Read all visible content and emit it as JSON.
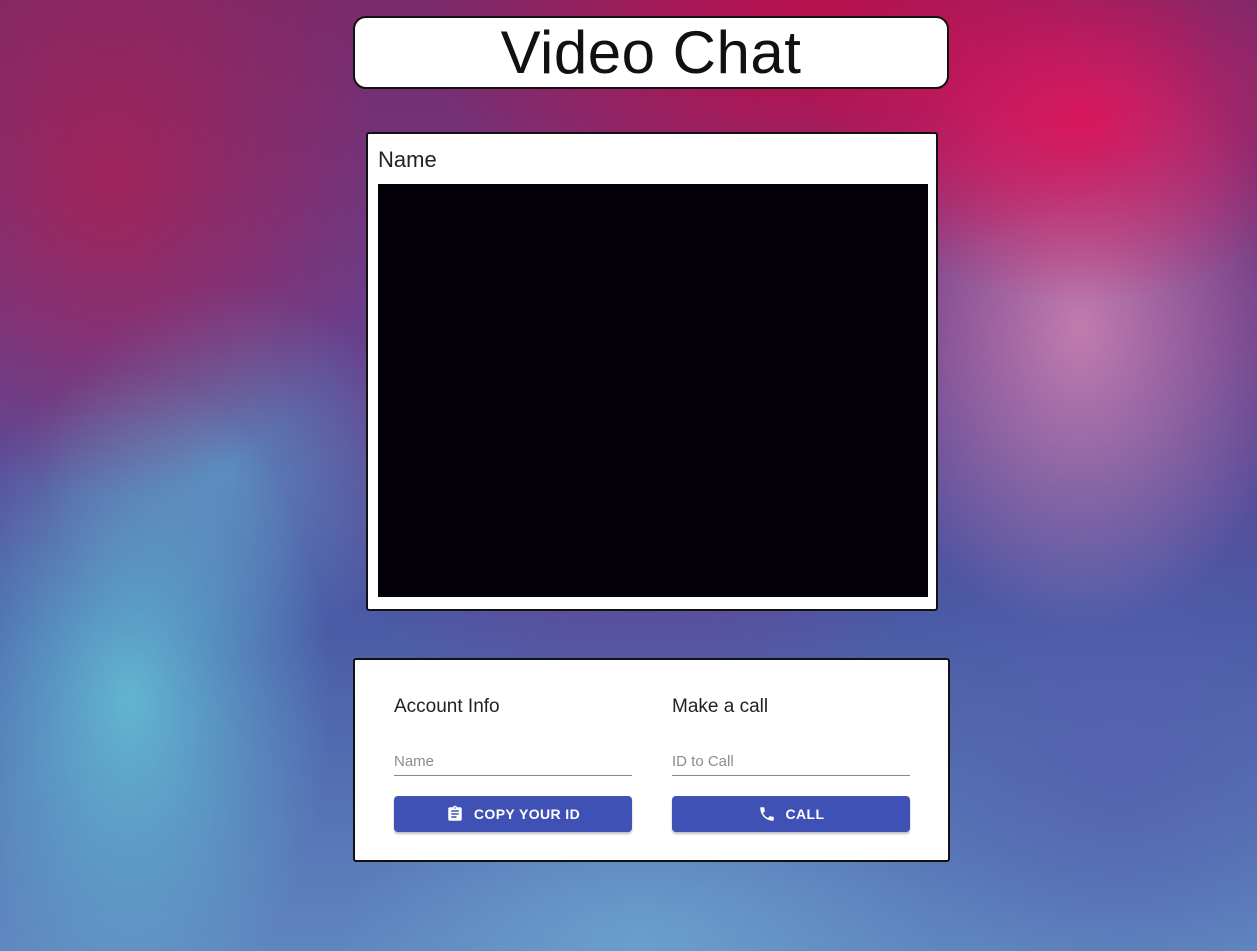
{
  "header": {
    "title": "Video Chat"
  },
  "video": {
    "name_label": "Name"
  },
  "account": {
    "heading": "Account Info",
    "name_placeholder": "Name",
    "name_value": "",
    "copy_button_label": "COPY YOUR ID",
    "copy_button_icon": "clipboard-icon"
  },
  "call": {
    "heading": "Make a call",
    "id_placeholder": "ID to Call",
    "id_value": "",
    "call_button_label": "CALL",
    "call_button_icon": "phone-icon"
  },
  "colors": {
    "primary_button": "#3f51b5",
    "video_background": "#03000a"
  }
}
